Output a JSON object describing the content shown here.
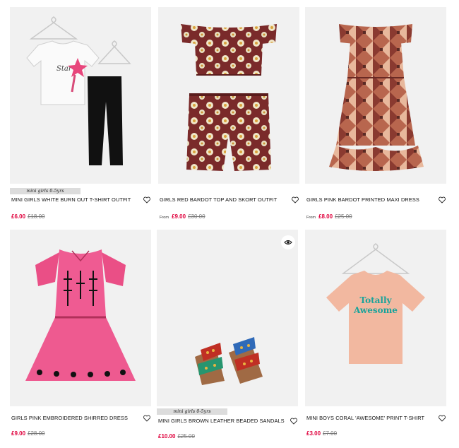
{
  "products": [
    {
      "tag": "mini girls 0-5yrs",
      "title": "MINI GIRLS WHITE BURN OUT T-SHIRT OUTFIT",
      "from": "",
      "price": "£6.00",
      "was": "£18.00"
    },
    {
      "tag": "",
      "title": "GIRLS RED BARDOT TOP AND SKORT OUTFIT",
      "from": "From",
      "price": "£9.00",
      "was": "£30.00"
    },
    {
      "tag": "",
      "title": "GIRLS PINK BARDOT PRINTED MAXI DRESS",
      "from": "From",
      "price": "£8.00",
      "was": "£25.00"
    },
    {
      "tag": "",
      "title": "GIRLS PINK EMBROIDERED SHIRRED DRESS",
      "from": "",
      "price": "£9.00",
      "was": "£28.00"
    },
    {
      "tag": "mini girls 0-5yrs",
      "title": "MINI GIRLS BROWN LEATHER BEADED SANDALS",
      "from": "",
      "price": "£10.00",
      "was": "£25.00"
    },
    {
      "tag": "",
      "title": "MINI BOYS CORAL 'AWESOME' PRINT T-SHIRT",
      "from": "",
      "price": "£3.00",
      "was": "£7.00"
    }
  ],
  "tshirt_print": [
    "Totally",
    "Awesome"
  ],
  "colors": {
    "sale_red": "#e0003c",
    "was_grey": "#777777",
    "image_bg": "#f1f1f1"
  },
  "icons": {
    "wishlist": "heart-icon",
    "quick_view": "eye-icon"
  }
}
